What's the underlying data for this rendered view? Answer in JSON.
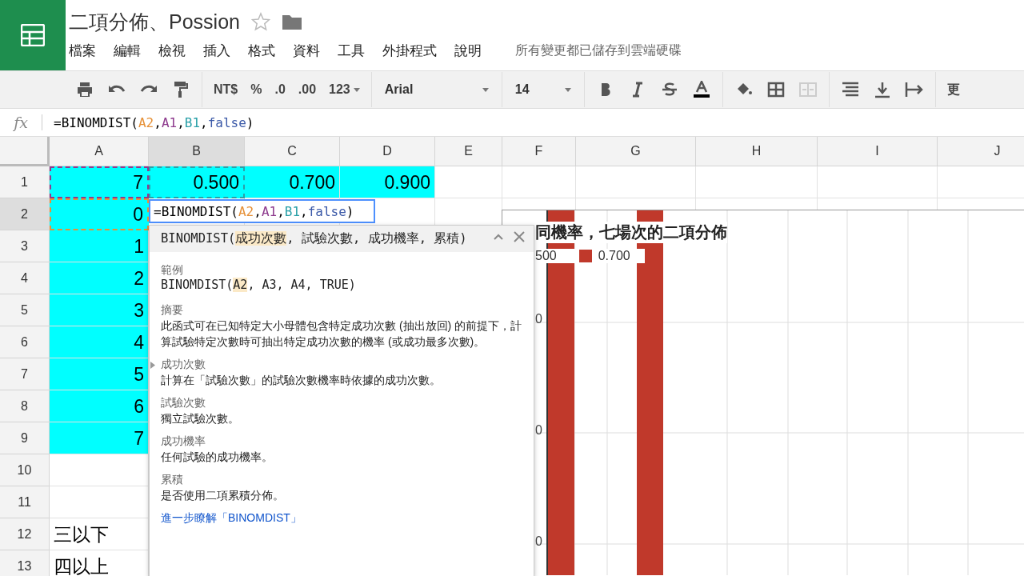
{
  "document": {
    "title": "二項分佈、Possion",
    "starred": false
  },
  "menu": [
    "檔案",
    "編輯",
    "檢視",
    "插入",
    "格式",
    "資料",
    "工具",
    "外掛程式",
    "說明"
  ],
  "save_status": "所有變更都已儲存到雲端硬碟",
  "toolbar": {
    "currency": "NT$",
    "percent": "%",
    "decrease_decimals": ".0",
    "increase_decimals": ".00",
    "number_format": "123",
    "font": "Arial",
    "font_size": "14",
    "more": "更"
  },
  "formula_bar": {
    "icon": "fx",
    "tokens": [
      {
        "text": "=BINOMDIST(",
        "kind": "plain"
      },
      {
        "text": "A2",
        "kind": "ref",
        "color": "#e69138"
      },
      {
        "text": ",",
        "kind": "plain"
      },
      {
        "text": "A1",
        "kind": "ref",
        "color": "#8e3b8e"
      },
      {
        "text": ",",
        "kind": "plain"
      },
      {
        "text": "B1",
        "kind": "ref",
        "color": "#2aa0a8"
      },
      {
        "text": ",",
        "kind": "plain"
      },
      {
        "text": "false",
        "kind": "ref",
        "color": "#3c5aa8"
      },
      {
        "text": ")",
        "kind": "plain"
      }
    ]
  },
  "columns": [
    {
      "label": "A",
      "selected": false
    },
    {
      "label": "B",
      "selected": true
    },
    {
      "label": "C",
      "selected": false
    },
    {
      "label": "D",
      "selected": false
    },
    {
      "label": "E",
      "selected": false
    },
    {
      "label": "F",
      "selected": false
    },
    {
      "label": "G",
      "selected": false
    },
    {
      "label": "H",
      "selected": false
    },
    {
      "label": "I",
      "selected": false
    },
    {
      "label": "J",
      "selected": false
    }
  ],
  "rows": [
    {
      "label": "1",
      "selected": false,
      "cells": [
        {
          "value": "7",
          "filled": true,
          "color": "#8e3b8e"
        },
        {
          "value": "0.500",
          "filled": true,
          "color": "#2aa0a8"
        },
        {
          "value": "0.700",
          "filled": true
        },
        {
          "value": "0.900",
          "filled": true
        }
      ]
    },
    {
      "label": "2",
      "selected": true,
      "cells": [
        {
          "value": "0",
          "filled": true,
          "color": "#e69138"
        }
      ]
    },
    {
      "label": "3",
      "selected": false,
      "cells": [
        {
          "value": "1",
          "filled": true
        }
      ]
    },
    {
      "label": "4",
      "selected": false,
      "cells": [
        {
          "value": "2",
          "filled": true
        }
      ]
    },
    {
      "label": "5",
      "selected": false,
      "cells": [
        {
          "value": "3",
          "filled": true
        }
      ]
    },
    {
      "label": "6",
      "selected": false,
      "cells": [
        {
          "value": "4",
          "filled": true
        }
      ]
    },
    {
      "label": "7",
      "selected": false,
      "cells": [
        {
          "value": "5",
          "filled": true
        }
      ]
    },
    {
      "label": "8",
      "selected": false,
      "cells": [
        {
          "value": "6",
          "filled": true
        }
      ]
    },
    {
      "label": "9",
      "selected": false,
      "cells": [
        {
          "value": "7",
          "filled": true
        }
      ]
    },
    {
      "label": "10",
      "selected": false,
      "cells": []
    },
    {
      "label": "11",
      "selected": false,
      "cells": []
    },
    {
      "label": "12",
      "selected": false,
      "cells": [
        {
          "value": "三以下",
          "filled": false,
          "kind": "text"
        }
      ]
    },
    {
      "label": "13",
      "selected": false,
      "cells": [
        {
          "value": "四以上",
          "filled": false,
          "kind": "text"
        }
      ]
    }
  ],
  "cell_editor": {
    "tokens": [
      {
        "text": "=BINOMDIST(",
        "kind": "plain"
      },
      {
        "text": "A2",
        "kind": "ref",
        "color": "#e69138"
      },
      {
        "text": ",",
        "kind": "plain"
      },
      {
        "text": "A1",
        "kind": "ref",
        "color": "#8e3b8e"
      },
      {
        "text": ",",
        "kind": "plain"
      },
      {
        "text": "B1",
        "kind": "ref",
        "color": "#2aa0a8"
      },
      {
        "text": ",",
        "kind": "plain"
      },
      {
        "text": "false",
        "kind": "ref",
        "color": "#3c5aa8"
      },
      {
        "text": ")",
        "kind": "plain"
      }
    ]
  },
  "help_popup": {
    "signature": [
      {
        "text": "BINOMDIST(",
        "highlighted": false
      },
      {
        "text": "成功次數",
        "highlighted": true
      },
      {
        "text": ", 試驗次數, 成功機率, 累積)",
        "highlighted": false
      }
    ],
    "example_label": "範例",
    "example": [
      {
        "text": "BINOMDIST(",
        "highlighted": false
      },
      {
        "text": "A2",
        "highlighted": true
      },
      {
        "text": ", A3, A4, TRUE)",
        "highlighted": false
      }
    ],
    "summary_label": "摘要",
    "summary": "此函式可在已知特定大小母體包含特定成功次數 (抽出放回) 的前提下，計算試驗特定次數時可抽出特定成功次數的機率 (或成功最多次數)。",
    "arguments": [
      {
        "name": "成功次數",
        "description": "計算在「試驗次數」的試驗次數機率時依據的成功次數。",
        "selected": true
      },
      {
        "name": "試驗次數",
        "description": "獨立試驗次數。",
        "selected": false
      },
      {
        "name": "成功機率",
        "description": "任何試驗的成功機率。",
        "selected": false
      },
      {
        "name": "累積",
        "description": "是否使用二項累積分佈。",
        "selected": false
      }
    ],
    "learn_more": "進一步瞭解「BINOMDIST」"
  },
  "chart": {
    "title": "同機率，七場次的二項分佈",
    "legend": [
      {
        "label": "500",
        "swatch": false,
        "color": "#c0392b"
      },
      {
        "label": "0.700",
        "swatch": true,
        "color": "#c0392b"
      }
    ],
    "axis_labels": [
      "0",
      "0",
      "0"
    ]
  }
}
